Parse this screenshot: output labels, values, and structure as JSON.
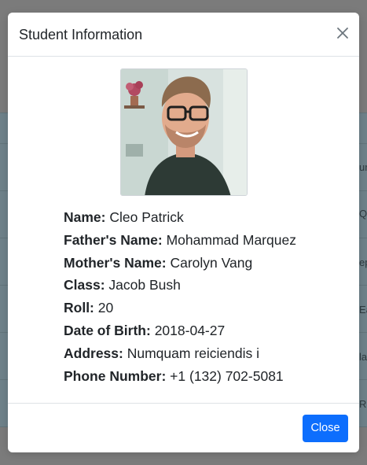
{
  "background": {
    "row_fragments": [
      "ur",
      "Qu",
      "ep",
      "Ea",
      "la",
      "Re"
    ]
  },
  "modal": {
    "title": "Student Information",
    "close_icon": "close-icon",
    "fields": [
      {
        "label": "Name:",
        "value": "Cleo Patrick"
      },
      {
        "label": "Father's Name:",
        "value": "Mohammad Marquez"
      },
      {
        "label": "Mother's Name:",
        "value": "Carolyn Vang"
      },
      {
        "label": "Class:",
        "value": "Jacob Bush"
      },
      {
        "label": "Roll:",
        "value": "20"
      },
      {
        "label": "Date of Birth:",
        "value": "2018-04-27"
      },
      {
        "label": "Address:",
        "value": "Numquam reiciendis i"
      },
      {
        "label": "Phone Number:",
        "value": "+1 (132) 702-5081"
      }
    ],
    "close_button_label": "Close"
  },
  "colors": {
    "primary_button": "#0d6efd",
    "backdrop": "#7b7b7b"
  }
}
